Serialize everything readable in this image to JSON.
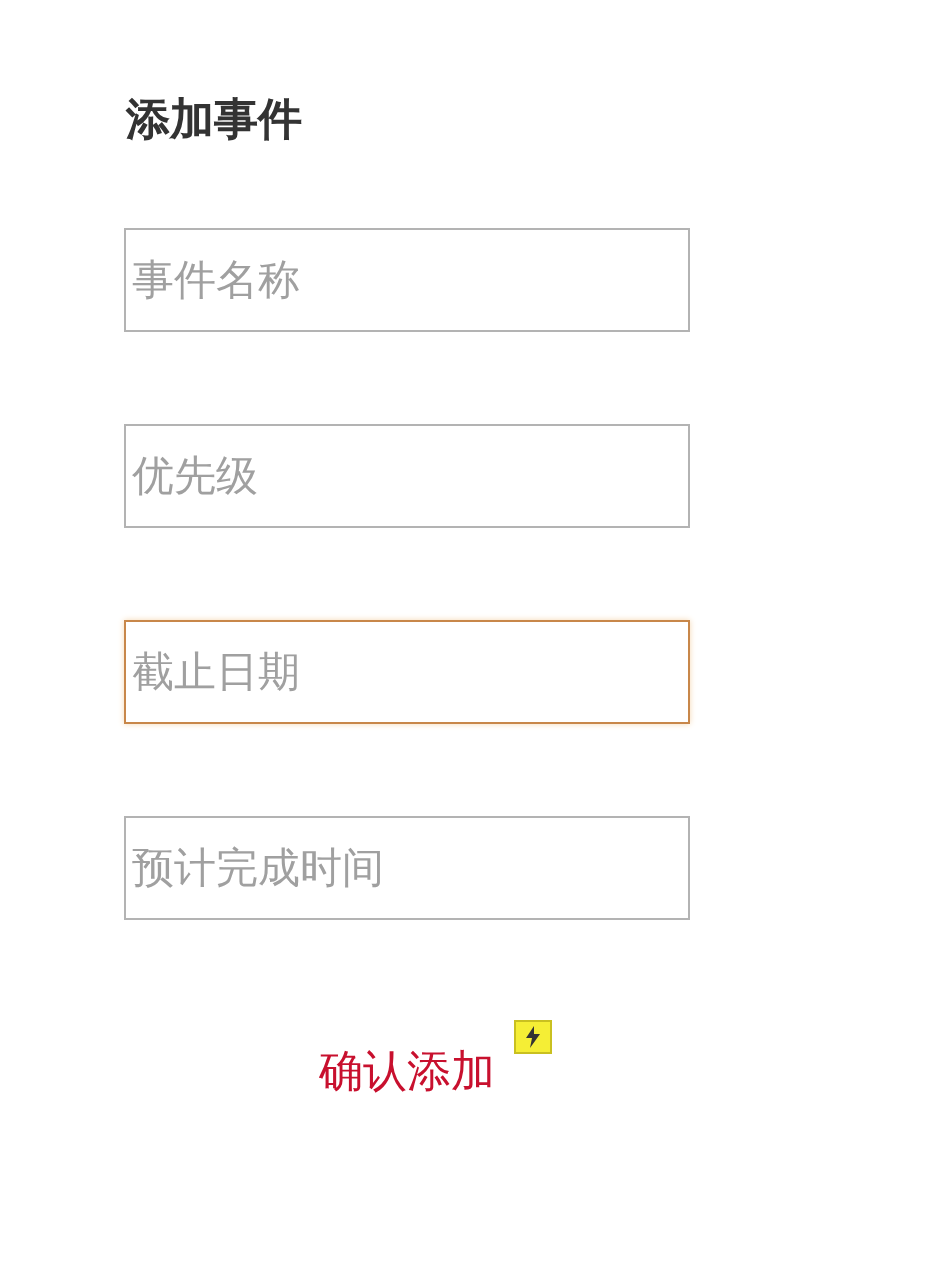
{
  "title": "添加事件",
  "fields": [
    {
      "placeholder": "事件名称",
      "focused": false
    },
    {
      "placeholder": "优先级",
      "focused": false
    },
    {
      "placeholder": "截止日期",
      "focused": true
    },
    {
      "placeholder": "预计完成时间",
      "focused": false
    }
  ],
  "submit": {
    "label": "确认添加"
  }
}
